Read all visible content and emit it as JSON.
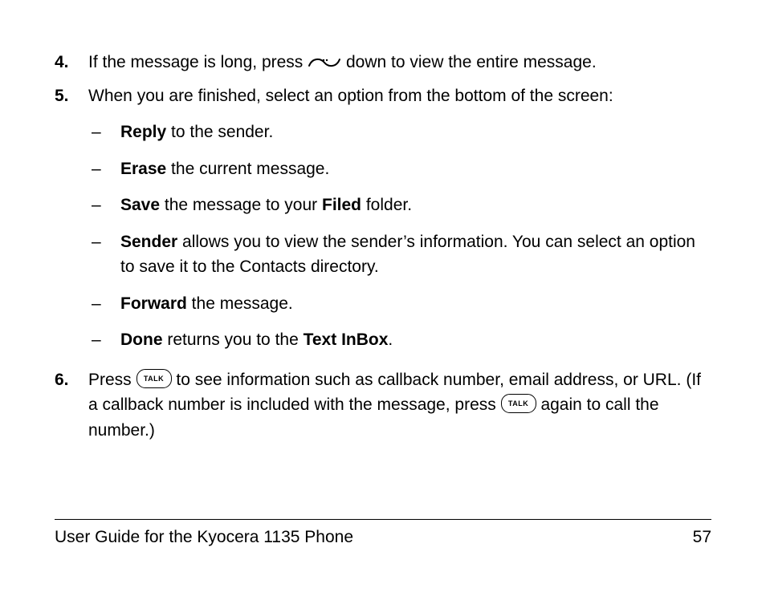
{
  "steps": {
    "s4": {
      "num": "4.",
      "pre": "If the message is long, press ",
      "post": " down to view the entire message."
    },
    "s5": {
      "num": "5.",
      "text": "When you are finished, select an option from the bottom of the screen:"
    },
    "s6": {
      "num": "6.",
      "pre": "Press ",
      "mid": " to see information such as callback number, email address, or URL. (If a callback number is included with the message, press ",
      "post": " again to call the number.)"
    }
  },
  "options": {
    "dash": "–",
    "reply": {
      "b": "Reply",
      "text": " to the sender."
    },
    "erase": {
      "b": "Erase",
      "text": " the current message."
    },
    "save": {
      "b1": "Save",
      "t1": " the message to your ",
      "b2": "Filed",
      "t2": " folder."
    },
    "sender": {
      "b": "Sender",
      "text": " allows you to view the sender’s information. You can select an option to save it to the Contacts directory."
    },
    "forward": {
      "b": "Forward",
      "text": " the message."
    },
    "done": {
      "b1": "Done",
      "t1": " returns you to the ",
      "b2": "Text InBox",
      "t2": "."
    }
  },
  "icons": {
    "talk": "TALK"
  },
  "footer": {
    "title": "User Guide for the Kyocera 1135 Phone",
    "page": "57"
  }
}
